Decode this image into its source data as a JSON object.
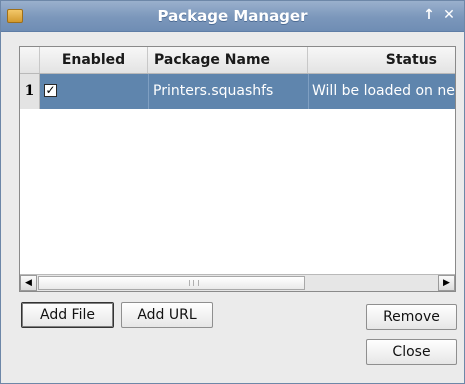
{
  "window": {
    "title": "Package Manager",
    "up_icon": "↑",
    "close_icon": "✕"
  },
  "table": {
    "columns": {
      "enabled": "Enabled",
      "name": "Package Name",
      "status": "Status"
    },
    "rows": [
      {
        "row_number": "1",
        "enabled": true,
        "check_glyph": "✓",
        "name": "Printers.squashfs",
        "status": "Will be loaded on ne"
      }
    ],
    "selected_row_color": "#5f85ad"
  },
  "scrollbar": {
    "left_arrow": "◀",
    "right_arrow": "▶"
  },
  "buttons": {
    "add_file": "Add File",
    "add_url": "Add URL",
    "remove": "Remove",
    "close": "Close"
  },
  "colors": {
    "titlebar": "#7b97bb",
    "window_bg": "#ebebeb"
  }
}
